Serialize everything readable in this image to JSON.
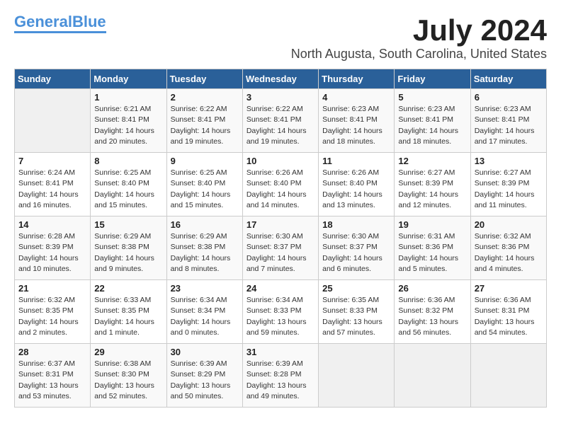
{
  "logo": {
    "general": "General",
    "blue": "Blue"
  },
  "title": "July 2024",
  "subtitle": "North Augusta, South Carolina, United States",
  "headers": [
    "Sunday",
    "Monday",
    "Tuesday",
    "Wednesday",
    "Thursday",
    "Friday",
    "Saturday"
  ],
  "weeks": [
    [
      {
        "day": "",
        "info": ""
      },
      {
        "day": "1",
        "info": "Sunrise: 6:21 AM\nSunset: 8:41 PM\nDaylight: 14 hours\nand 20 minutes."
      },
      {
        "day": "2",
        "info": "Sunrise: 6:22 AM\nSunset: 8:41 PM\nDaylight: 14 hours\nand 19 minutes."
      },
      {
        "day": "3",
        "info": "Sunrise: 6:22 AM\nSunset: 8:41 PM\nDaylight: 14 hours\nand 19 minutes."
      },
      {
        "day": "4",
        "info": "Sunrise: 6:23 AM\nSunset: 8:41 PM\nDaylight: 14 hours\nand 18 minutes."
      },
      {
        "day": "5",
        "info": "Sunrise: 6:23 AM\nSunset: 8:41 PM\nDaylight: 14 hours\nand 18 minutes."
      },
      {
        "day": "6",
        "info": "Sunrise: 6:23 AM\nSunset: 8:41 PM\nDaylight: 14 hours\nand 17 minutes."
      }
    ],
    [
      {
        "day": "7",
        "info": "Sunrise: 6:24 AM\nSunset: 8:41 PM\nDaylight: 14 hours\nand 16 minutes."
      },
      {
        "day": "8",
        "info": "Sunrise: 6:25 AM\nSunset: 8:40 PM\nDaylight: 14 hours\nand 15 minutes."
      },
      {
        "day": "9",
        "info": "Sunrise: 6:25 AM\nSunset: 8:40 PM\nDaylight: 14 hours\nand 15 minutes."
      },
      {
        "day": "10",
        "info": "Sunrise: 6:26 AM\nSunset: 8:40 PM\nDaylight: 14 hours\nand 14 minutes."
      },
      {
        "day": "11",
        "info": "Sunrise: 6:26 AM\nSunset: 8:40 PM\nDaylight: 14 hours\nand 13 minutes."
      },
      {
        "day": "12",
        "info": "Sunrise: 6:27 AM\nSunset: 8:39 PM\nDaylight: 14 hours\nand 12 minutes."
      },
      {
        "day": "13",
        "info": "Sunrise: 6:27 AM\nSunset: 8:39 PM\nDaylight: 14 hours\nand 11 minutes."
      }
    ],
    [
      {
        "day": "14",
        "info": "Sunrise: 6:28 AM\nSunset: 8:39 PM\nDaylight: 14 hours\nand 10 minutes."
      },
      {
        "day": "15",
        "info": "Sunrise: 6:29 AM\nSunset: 8:38 PM\nDaylight: 14 hours\nand 9 minutes."
      },
      {
        "day": "16",
        "info": "Sunrise: 6:29 AM\nSunset: 8:38 PM\nDaylight: 14 hours\nand 8 minutes."
      },
      {
        "day": "17",
        "info": "Sunrise: 6:30 AM\nSunset: 8:37 PM\nDaylight: 14 hours\nand 7 minutes."
      },
      {
        "day": "18",
        "info": "Sunrise: 6:30 AM\nSunset: 8:37 PM\nDaylight: 14 hours\nand 6 minutes."
      },
      {
        "day": "19",
        "info": "Sunrise: 6:31 AM\nSunset: 8:36 PM\nDaylight: 14 hours\nand 5 minutes."
      },
      {
        "day": "20",
        "info": "Sunrise: 6:32 AM\nSunset: 8:36 PM\nDaylight: 14 hours\nand 4 minutes."
      }
    ],
    [
      {
        "day": "21",
        "info": "Sunrise: 6:32 AM\nSunset: 8:35 PM\nDaylight: 14 hours\nand 2 minutes."
      },
      {
        "day": "22",
        "info": "Sunrise: 6:33 AM\nSunset: 8:35 PM\nDaylight: 14 hours\nand 1 minute."
      },
      {
        "day": "23",
        "info": "Sunrise: 6:34 AM\nSunset: 8:34 PM\nDaylight: 14 hours\nand 0 minutes."
      },
      {
        "day": "24",
        "info": "Sunrise: 6:34 AM\nSunset: 8:33 PM\nDaylight: 13 hours\nand 59 minutes."
      },
      {
        "day": "25",
        "info": "Sunrise: 6:35 AM\nSunset: 8:33 PM\nDaylight: 13 hours\nand 57 minutes."
      },
      {
        "day": "26",
        "info": "Sunrise: 6:36 AM\nSunset: 8:32 PM\nDaylight: 13 hours\nand 56 minutes."
      },
      {
        "day": "27",
        "info": "Sunrise: 6:36 AM\nSunset: 8:31 PM\nDaylight: 13 hours\nand 54 minutes."
      }
    ],
    [
      {
        "day": "28",
        "info": "Sunrise: 6:37 AM\nSunset: 8:31 PM\nDaylight: 13 hours\nand 53 minutes."
      },
      {
        "day": "29",
        "info": "Sunrise: 6:38 AM\nSunset: 8:30 PM\nDaylight: 13 hours\nand 52 minutes."
      },
      {
        "day": "30",
        "info": "Sunrise: 6:39 AM\nSunset: 8:29 PM\nDaylight: 13 hours\nand 50 minutes."
      },
      {
        "day": "31",
        "info": "Sunrise: 6:39 AM\nSunset: 8:28 PM\nDaylight: 13 hours\nand 49 minutes."
      },
      {
        "day": "",
        "info": ""
      },
      {
        "day": "",
        "info": ""
      },
      {
        "day": "",
        "info": ""
      }
    ]
  ]
}
